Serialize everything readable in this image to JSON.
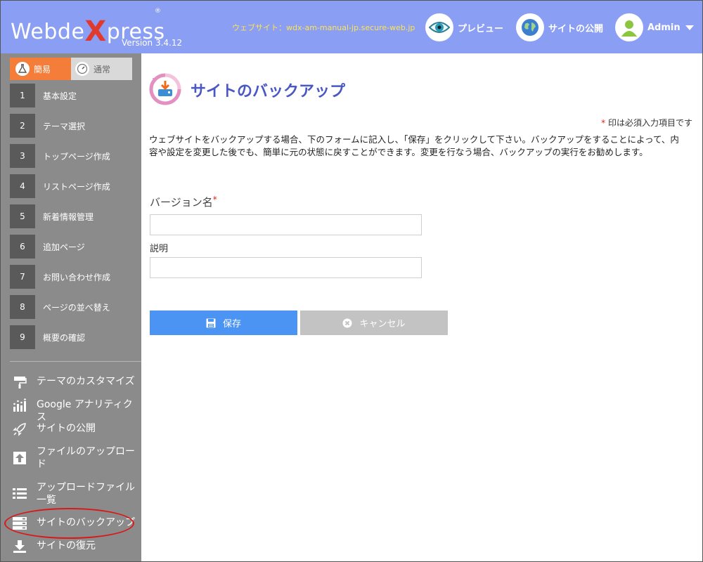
{
  "header": {
    "logo_text": "Webde",
    "logo_x": "X",
    "logo_suffix": "press",
    "logo_reg": "®",
    "version": "Version 3.4.12",
    "site_url": "ウェブサイト：wdx-am-manual-jp.secure-web.jp",
    "preview_label": "プレビュー",
    "publish_label": "サイトの公開",
    "admin_label": "Admin"
  },
  "sidebar": {
    "mode_easy": "簡易",
    "mode_normal": "通常",
    "steps": [
      {
        "num": "1",
        "label": "基本設定"
      },
      {
        "num": "2",
        "label": "テーマ選択"
      },
      {
        "num": "3",
        "label": "トップページ作成"
      },
      {
        "num": "4",
        "label": "リストページ作成"
      },
      {
        "num": "5",
        "label": "新着情報管理"
      },
      {
        "num": "6",
        "label": "追加ページ"
      },
      {
        "num": "7",
        "label": "お問い合わせ作成"
      },
      {
        "num": "8",
        "label": "ページの並べ替え"
      },
      {
        "num": "9",
        "label": "概要の確認"
      }
    ],
    "menu": [
      {
        "label": "テーマのカスタマイズ",
        "icon": "paint-roller-icon"
      },
      {
        "label": "Google アナリティクス",
        "icon": "bar-chart-icon"
      },
      {
        "label": "サイトの公開",
        "icon": "rocket-icon"
      },
      {
        "label": "ファイルのアップロード",
        "icon": "upload-icon"
      },
      {
        "label": "アップロードファイル一覧",
        "icon": "list-icon"
      },
      {
        "label": "サイトのバックアップ",
        "icon": "server-icon"
      },
      {
        "label": "サイトの復元",
        "icon": "download-icon"
      }
    ]
  },
  "main": {
    "title": "サイトのバックアップ",
    "required_mark": "*",
    "required_note": " 印は必須入力項目です",
    "description": "ウェブサイトをバックアップする場合、下のフォームに記入し、「保存」をクリックして下さい。バックアップをすることによって、内容や設定を変更した後でも、簡単に元の状態に戻すことができます。変更を行なう場合、バックアップの実行をお勧めします。",
    "version_label": "バージョン名",
    "version_value": "",
    "desc_label": "説明",
    "desc_value": "",
    "save_label": "保存",
    "cancel_label": "キャンセル"
  },
  "colors": {
    "header_bg": "#8a9ef3",
    "sidebar_bg": "#8b8b8b",
    "accent_orange": "#f47d3a",
    "title_blue": "#4a58c4",
    "save_blue": "#4b94f4",
    "required_red": "#d9261c"
  }
}
